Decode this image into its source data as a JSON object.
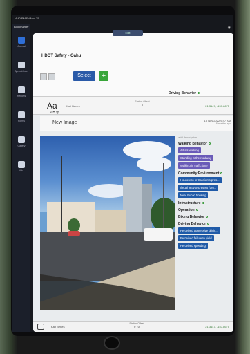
{
  "statusbar": {
    "left": "4:40 PM  Fri Nov 25",
    "right": ""
  },
  "rail": {
    "brand": "Bookmarker",
    "items": [
      {
        "label": "Journal",
        "icon": "map-icon",
        "active": true
      },
      {
        "label": "Spreadsheet",
        "icon": "grid-icon",
        "active": false
      },
      {
        "label": "Reports",
        "icon": "report-icon",
        "active": false
      },
      {
        "label": "Forms",
        "icon": "form-icon",
        "active": false
      },
      {
        "label": "Gallery",
        "icon": "gallery-icon",
        "active": false
      },
      {
        "label": "Add",
        "icon": "plus-icon",
        "active": false
      }
    ]
  },
  "handle_label": "Edit",
  "header": {
    "org_title": "HDOT Safety - Oahu",
    "select_label": "Select",
    "add_label": "+",
    "right_label": "Driving Behavior"
  },
  "record": {
    "aa": "Aa",
    "who": "Kari Benes",
    "station_label": "Station",
    "offset_label": "Offset",
    "station": "0",
    "offset": "0",
    "coords": "21.3147, -157.8675"
  },
  "new_image": {
    "title": "New Image",
    "date": "15 Nov 2022 9:47 AM",
    "ago": "8 months ago"
  },
  "panel": {
    "intro": "add description",
    "walking": {
      "label": "Walking Behavior",
      "chips": [
        "Adults walking",
        "Standing in the roadway",
        "Walking in traffic lane"
      ]
    },
    "community": {
      "label": "Community Environment",
      "chips": [
        "Houseless or transients pres...",
        "Illegal activity present (dru...",
        "Near Public housing"
      ]
    },
    "infrastructure": "Infrastructure",
    "operation": "Operation",
    "biking": "Biking Behavior",
    "driving": {
      "label": "Driving Behavior",
      "chips": [
        "Perceived aggressive drivin...",
        "Perceived failure to yield",
        "Perceived speeding"
      ]
    }
  },
  "footer": {
    "who": "Kari Benes",
    "station_label": "Station",
    "offset_label": "Offset",
    "station": "0",
    "offset": "0",
    "coords": "21.3147, -157.8675"
  },
  "colors": {
    "accent": "#2a5aa8",
    "add": "#39a53a",
    "chip_purple": "#6a5bb8",
    "chip_blue": "#1f5aa8"
  }
}
